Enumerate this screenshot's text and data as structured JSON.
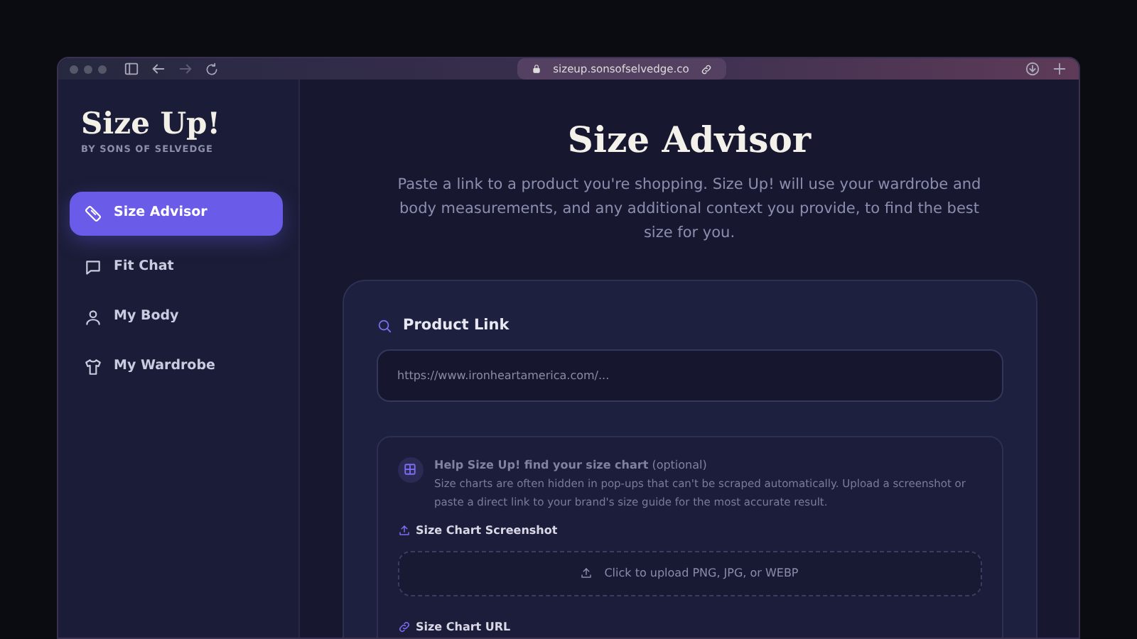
{
  "browser": {
    "url": "sizeup.sonsofselvedge.co"
  },
  "sidebar": {
    "logo": "Size Up!",
    "tagline": "BY SONS OF SELVEDGE",
    "items": [
      {
        "label": "Size Advisor",
        "kind": "ruler",
        "selected": true
      },
      {
        "label": "Fit Chat",
        "kind": "chat",
        "selected": false
      },
      {
        "label": "My Body",
        "kind": "person",
        "selected": false
      },
      {
        "label": "My Wardrobe",
        "kind": "shirt",
        "selected": false
      }
    ]
  },
  "main": {
    "title": "Size Advisor",
    "description": "Paste a link to a product you're shopping. Size Up! will use your wardrobe and body measurements, and any additional context you provide, to find the best size for you.",
    "product_link": {
      "label": "Product Link",
      "placeholder": "https://www.ironheartamerica.com/..."
    },
    "size_chart_help": {
      "title": "**Help Size Up! find your size chart** (optional)",
      "text": "Size charts are often hidden in pop-ups that can't be scraped automatically. Upload a screenshot or paste a direct link to your brand's size guide for the most accurate result.",
      "screenshot_label": "Size Chart Screenshot",
      "upload_prompt": "Click to upload PNG, JPG, or WEBP",
      "url_label": "Size Chart URL"
    }
  }
}
